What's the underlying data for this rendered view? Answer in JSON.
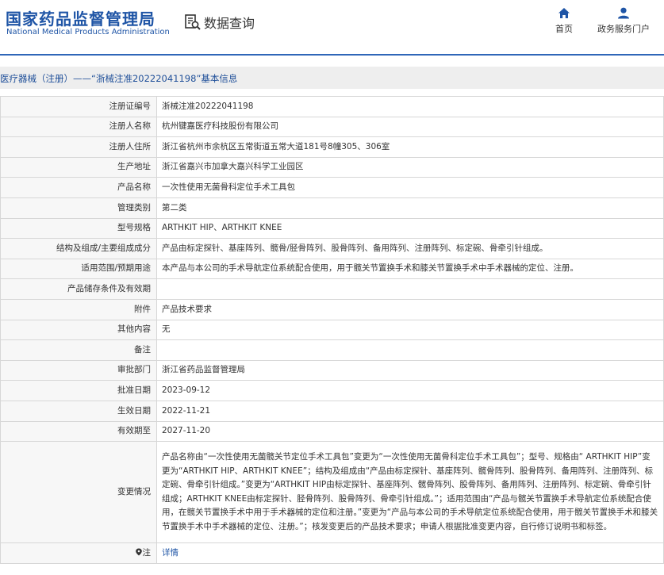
{
  "header": {
    "logo_cn": "国家药品监督管理局",
    "logo_en": "National Medical Products Administration",
    "module_icon": "search-document-icon",
    "module_title": "数据查询",
    "nav": [
      {
        "label": "首页",
        "icon": "home-icon"
      },
      {
        "label": "政务服务门户",
        "icon": "user-icon"
      }
    ],
    "accent_color": "#1f55a6"
  },
  "breadcrumb": "医疗器械（注册）——“浙械注准20222041198”基本信息",
  "fields": [
    {
      "label": "注册证编号",
      "value": "浙械注准20222041198"
    },
    {
      "label": "注册人名称",
      "value": "杭州键嘉医疗科技股份有限公司"
    },
    {
      "label": "注册人住所",
      "value": "浙江省杭州市余杭区五常街道五常大道181号8幢305、306室"
    },
    {
      "label": "生产地址",
      "value": "浙江省嘉兴市加拿大嘉兴科学工业园区"
    },
    {
      "label": "产品名称",
      "value": "一次性使用无菌骨科定位手术工具包"
    },
    {
      "label": "管理类别",
      "value": "第二类"
    },
    {
      "label": "型号规格",
      "value": "ARTHKIT HIP、ARTHKIT KNEE"
    },
    {
      "label": "结构及组成/主要组成成分",
      "value": "产品由标定探针、基座阵列、髋骨/胫骨阵列、股骨阵列、备用阵列、注册阵列、标定碗、骨牵引针组成。"
    },
    {
      "label": "适用范围/预期用途",
      "value": "本产品与本公司的手术导航定位系统配合使用，用于髋关节置换手术和膝关节置换手术中手术器械的定位、注册。"
    },
    {
      "label": "产品储存条件及有效期",
      "value": ""
    },
    {
      "label": "附件",
      "value": "产品技术要求"
    },
    {
      "label": "其他内容",
      "value": "无"
    },
    {
      "label": "备注",
      "value": ""
    },
    {
      "label": "审批部门",
      "value": "浙江省药品监督管理局"
    },
    {
      "label": "批准日期",
      "value": "2023-09-12"
    },
    {
      "label": "生效日期",
      "value": "2022-11-21"
    },
    {
      "label": "有效期至",
      "value": "2027-11-20"
    }
  ],
  "change": {
    "label": "变更情况",
    "value": "产品名称由“一次性使用无菌髋关节定位手术工具包”变更为“一次性使用无菌骨科定位手术工具包”；型号、规格由“ ARTHKIT HIP”变更为“ARTHKIT HIP、ARTHKIT KNEE”；结构及组成由“产品由标定探针、基座阵列、髋骨阵列、股骨阵列、备用阵列、注册阵列、标定碗、骨牵引针组成。”变更为“ARTHKIT HIP由标定探针、基座阵列、髋骨阵列、股骨阵列、备用阵列、注册阵列、标定碗、骨牵引针组成；ARTHKIT KNEE由标定探针、胫骨阵列、股骨阵列、骨牵引针组成。”；适用范围由“产品与髋关节置换手术导航定位系统配合使用，在髋关节置换手术中用于手术器械的定位和注册。”变更为“产品与本公司的手术导航定位系统配合使用，用于髋关节置换手术和膝关节置换手术中手术器械的定位、注册。”；核发变更后的产品技术要求；申请人根据批准变更内容，自行修订说明书和标签。"
  },
  "detail": {
    "label": "注",
    "icon": "location-pin-icon",
    "link": "详情"
  }
}
